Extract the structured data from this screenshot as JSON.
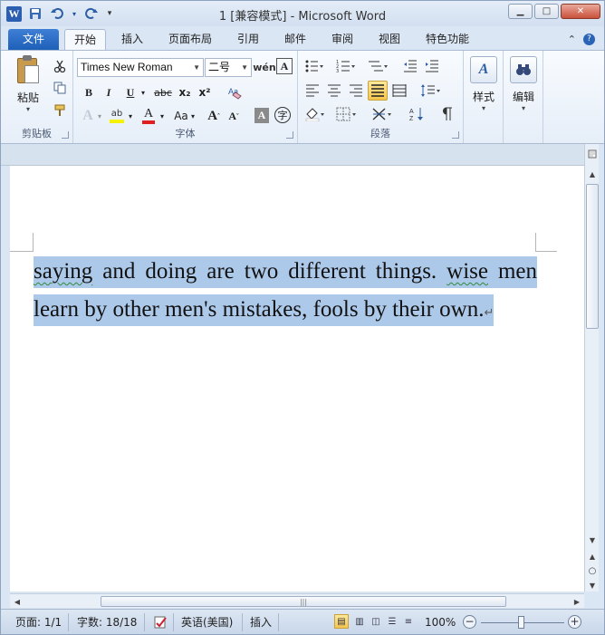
{
  "titlebar": {
    "title": "1 [兼容模式] - Microsoft Word",
    "app_icon": "W",
    "qat": [
      "save-icon",
      "undo-icon",
      "redo-icon",
      "customize-qat-icon"
    ]
  },
  "tabs": {
    "file": "文件",
    "items": [
      "开始",
      "插入",
      "页面布局",
      "引用",
      "邮件",
      "审阅",
      "视图",
      "特色功能"
    ],
    "active": "开始"
  },
  "ribbon": {
    "clipboard": {
      "paste": "粘贴",
      "label": "剪贴板"
    },
    "font": {
      "family": "Times New Roman",
      "size": "二号",
      "bold": "B",
      "italic": "I",
      "underline": "U",
      "strike": "abc",
      "subscript": "x₂",
      "superscript": "x²",
      "grow": "A",
      "shrink": "A",
      "case": "Aa",
      "label": "字体"
    },
    "paragraph": {
      "label": "段落"
    },
    "styles": {
      "label": "样式"
    },
    "editing": {
      "label": "编辑"
    }
  },
  "document": {
    "text_part1": "saying",
    "text_part2": " and doing are two different things. ",
    "text_part3": "wise",
    "text_part4": " men learn by other men's mistakes, fools by their own.",
    "paragraph_mark": "↵"
  },
  "statusbar": {
    "page": "页面: 1/1",
    "words": "字数: 18/18",
    "language": "英语(美国)",
    "mode": "插入",
    "zoom": "100%"
  },
  "colors": {
    "selection": "#adc9ea",
    "file_tab": "#2a63b9",
    "highlight": "#f6c64d"
  }
}
